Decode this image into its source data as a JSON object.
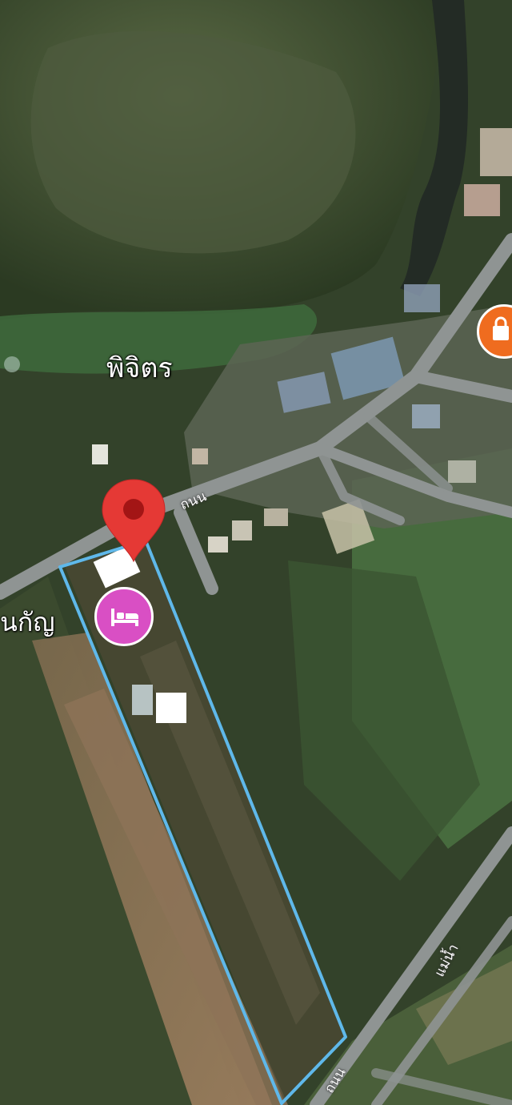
{
  "map": {
    "type": "satellite",
    "labels": {
      "area": "พิจิตร",
      "left_partial": "นกัญ",
      "road_top": "ถนน",
      "road_bottom": "ถนน",
      "river_road": "แม่น้ำ"
    },
    "markers": {
      "dropped_pin": "map-pin-icon",
      "hotel_poi": "bed-icon",
      "shop_poi": "shopping-bag-icon"
    },
    "colors": {
      "pin": "#e53935",
      "hotel": "#d94fc4",
      "shop": "#ef6c1f",
      "parcel_outline": "#5fb8ea",
      "road": "#8f9493"
    }
  }
}
